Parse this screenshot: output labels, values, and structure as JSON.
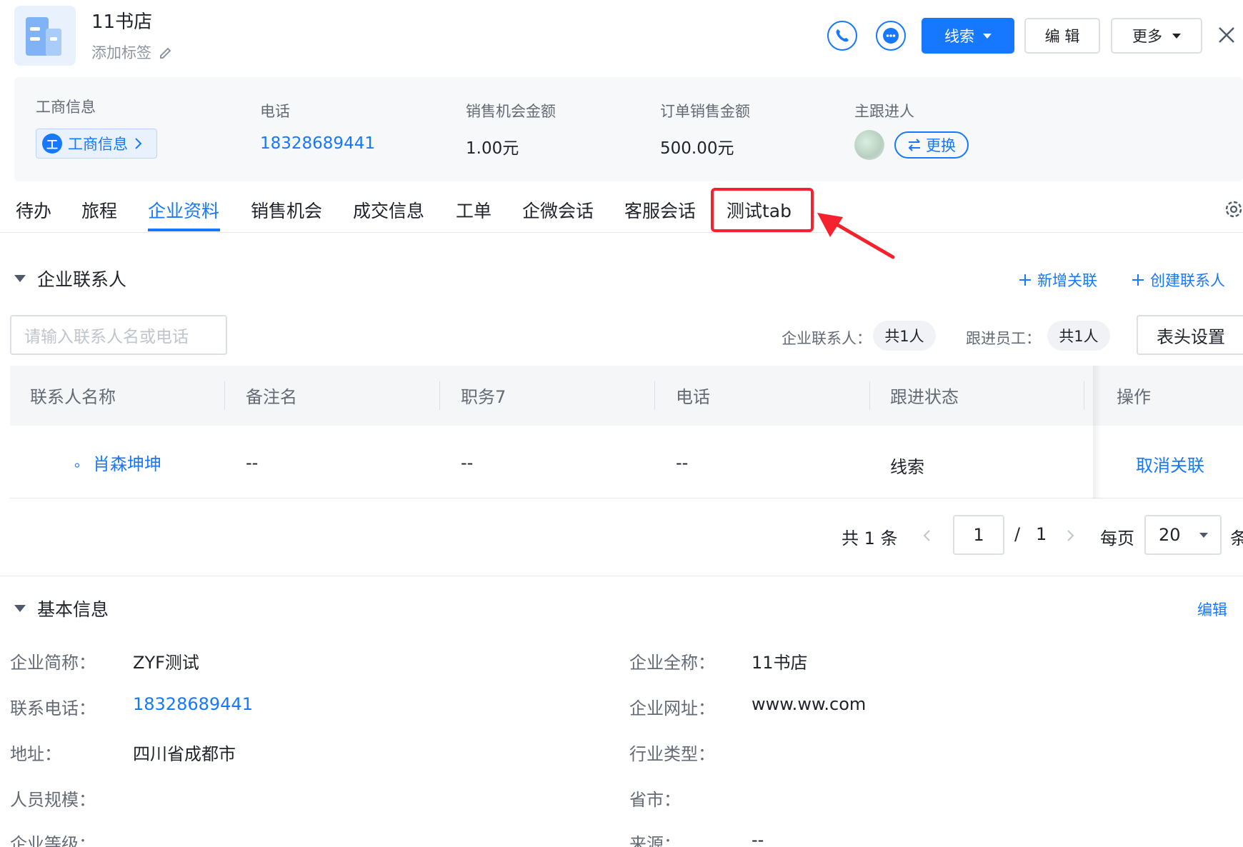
{
  "header": {
    "title": "11书店",
    "add_tag": "添加标签",
    "lead_button": "线索",
    "edit_button": "编 辑",
    "more_button": "更多"
  },
  "summary": {
    "biz_info_label": "工商信息",
    "biz_info_tag": "工商信息",
    "biz_icon_char": "工",
    "phone_label": "电话",
    "phone_value": "18328689441",
    "opportunity_label": "销售机会金额",
    "opportunity_value": "1.00元",
    "order_label": "订单销售金额",
    "order_value": "500.00元",
    "owner_label": "主跟进人",
    "change_button": "更换"
  },
  "tabs": [
    "待办",
    "旅程",
    "企业资料",
    "销售机会",
    "成交信息",
    "工单",
    "企微会话",
    "客服会话",
    "测试tab"
  ],
  "contacts": {
    "title": "企业联系人",
    "add_relation": "新增关联",
    "create_contact": "创建联系人",
    "search_placeholder": "请输入联系人名或电话",
    "contact_count_label": "企业联系人：",
    "contact_count": "共1人",
    "staff_count_label": "跟进员工：",
    "staff_count": "共1人",
    "header_setting": "表头设置",
    "columns": [
      "联系人名称",
      "备注名",
      "职务7",
      "电话",
      "跟进状态",
      "操作"
    ],
    "rows": [
      {
        "name_prefix": "。",
        "name": "肖森坤坤",
        "remark": "--",
        "position": "--",
        "phone": "--",
        "status": "线索",
        "action": "取消关联"
      }
    ],
    "pagination": {
      "total": "共 1 条",
      "page": "1",
      "sep": "/",
      "pages": "1",
      "per_page_label": "每页",
      "page_size": "20",
      "unit": "条"
    }
  },
  "basic_info": {
    "title": "基本信息",
    "edit": "编辑",
    "fields": [
      {
        "label": "企业简称：",
        "value": "ZYF测试"
      },
      {
        "label": "企业全称：",
        "value": "11书店"
      },
      {
        "label": "联系电话：",
        "value": "18328689441"
      },
      {
        "label": "企业网址：",
        "value": "www.ww.com"
      },
      {
        "label": "地址：",
        "value": "四川省成都市"
      },
      {
        "label": "行业类型：",
        "value": ""
      },
      {
        "label": "人员规模：",
        "value": ""
      },
      {
        "label": "省市：",
        "value": ""
      },
      {
        "label": "企业等级：",
        "value": ""
      },
      {
        "label": "来源：",
        "value": "--"
      }
    ]
  },
  "colors": {
    "primary": "#1677ff",
    "annotation_red": "#f5222d",
    "text": "#1f2329",
    "muted": "#646a73"
  }
}
